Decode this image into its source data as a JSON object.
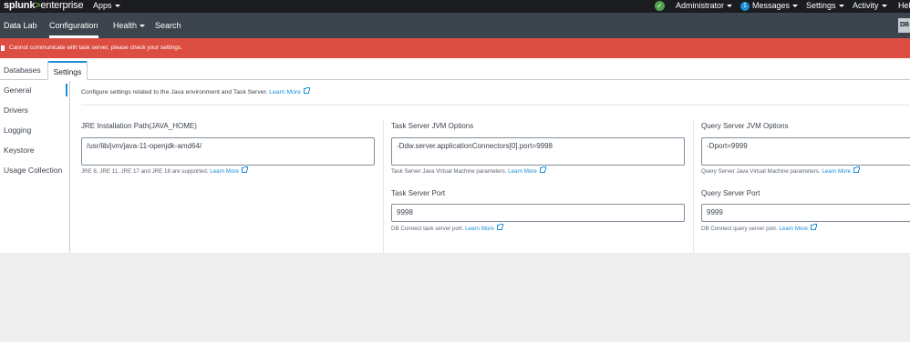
{
  "topbar": {
    "logo_brand": "splunk",
    "logo_sep": ">",
    "logo_product": "enterprise",
    "apps": "Apps",
    "user": "Administrator",
    "messages_count": "1",
    "messages": "Messages",
    "settings": "Settings",
    "activity": "Activity",
    "help": "Help"
  },
  "appbar": {
    "items": [
      "Data Lab",
      "Configuration",
      "Health",
      "Search"
    ],
    "active": "Configuration",
    "avatar": "DB"
  },
  "alert": {
    "text": "Cannot communicate with task server, please check your settings."
  },
  "tabs": [
    "Databases",
    "Settings"
  ],
  "sidebar": {
    "items": [
      "General",
      "Drivers",
      "Logging",
      "Keystore",
      "Usage Collection"
    ],
    "active": "General"
  },
  "general": {
    "intro": "Configure settings related to the Java environment and Task Server.",
    "intro_link": "Learn More",
    "jre": {
      "label": "JRE Installation Path(JAVA_HOME)",
      "value": "/usr/lib/jvm/java-11-openjdk-amd64/",
      "help": "JRE 8, JRE 11, JRE 17 and JRE 18 are supported.",
      "help_link": "Learn More"
    },
    "task_jvm": {
      "label": "Task Server JVM Options",
      "value": "-Ddw.server.applicationConnectors[0].port=9998",
      "help": "Task Server Java Virtual Machine parameters.",
      "help_link": "Learn More"
    },
    "task_port": {
      "label": "Task Server Port",
      "value": "9998",
      "help": "DB Connect task server port.",
      "help_link": "Learn More"
    },
    "query_jvm": {
      "label": "Query Server JVM Options",
      "value": "-Dport=9999",
      "help": "Query Server Java Virtual Machine parameters.",
      "help_link": "Learn More"
    },
    "query_port": {
      "label": "Query Server Port",
      "value": "9999",
      "help": "DB Connect query server port.",
      "help_link": "Learn More"
    }
  },
  "colors": {
    "accent": "#1a8fd6",
    "alert": "#dc4e41",
    "status_ok": "#53a051"
  }
}
